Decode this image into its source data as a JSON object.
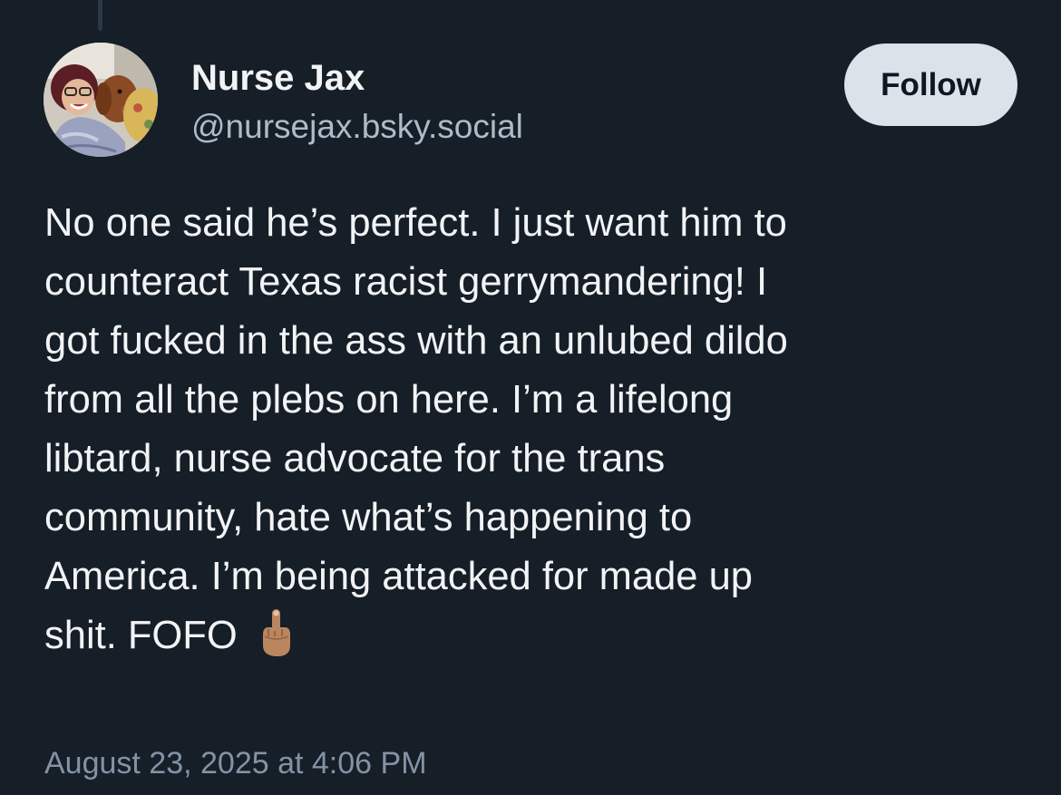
{
  "post": {
    "author": {
      "display_name": "Nurse Jax",
      "handle": "@nursejax.bsky.social",
      "avatar": "profile-photo-woman-with-dog"
    },
    "follow_label": "Follow",
    "text_lines": [
      "No one said he’s perfect. I just want him to",
      "counteract Texas racist gerrymandering! I",
      "got fucked in the ass with an unlubed dildo",
      "from all the plebs on here. I’m a lifelong",
      "libtard, nurse advocate for the trans",
      "community, hate what’s happening to",
      "America. I’m being attacked for made up",
      "shit. FOFO"
    ],
    "emoji": "middle-finger-medium-skin-tone",
    "timestamp": "August 23, 2025 at 4:06 PM"
  },
  "colors": {
    "background": "#161e27",
    "primary_text": "#f1f3f5",
    "secondary_text": "#aebbc9",
    "timestamp_text": "#8393a5",
    "follow_button_bg": "#dce2ea",
    "follow_button_text": "#0f1720"
  }
}
